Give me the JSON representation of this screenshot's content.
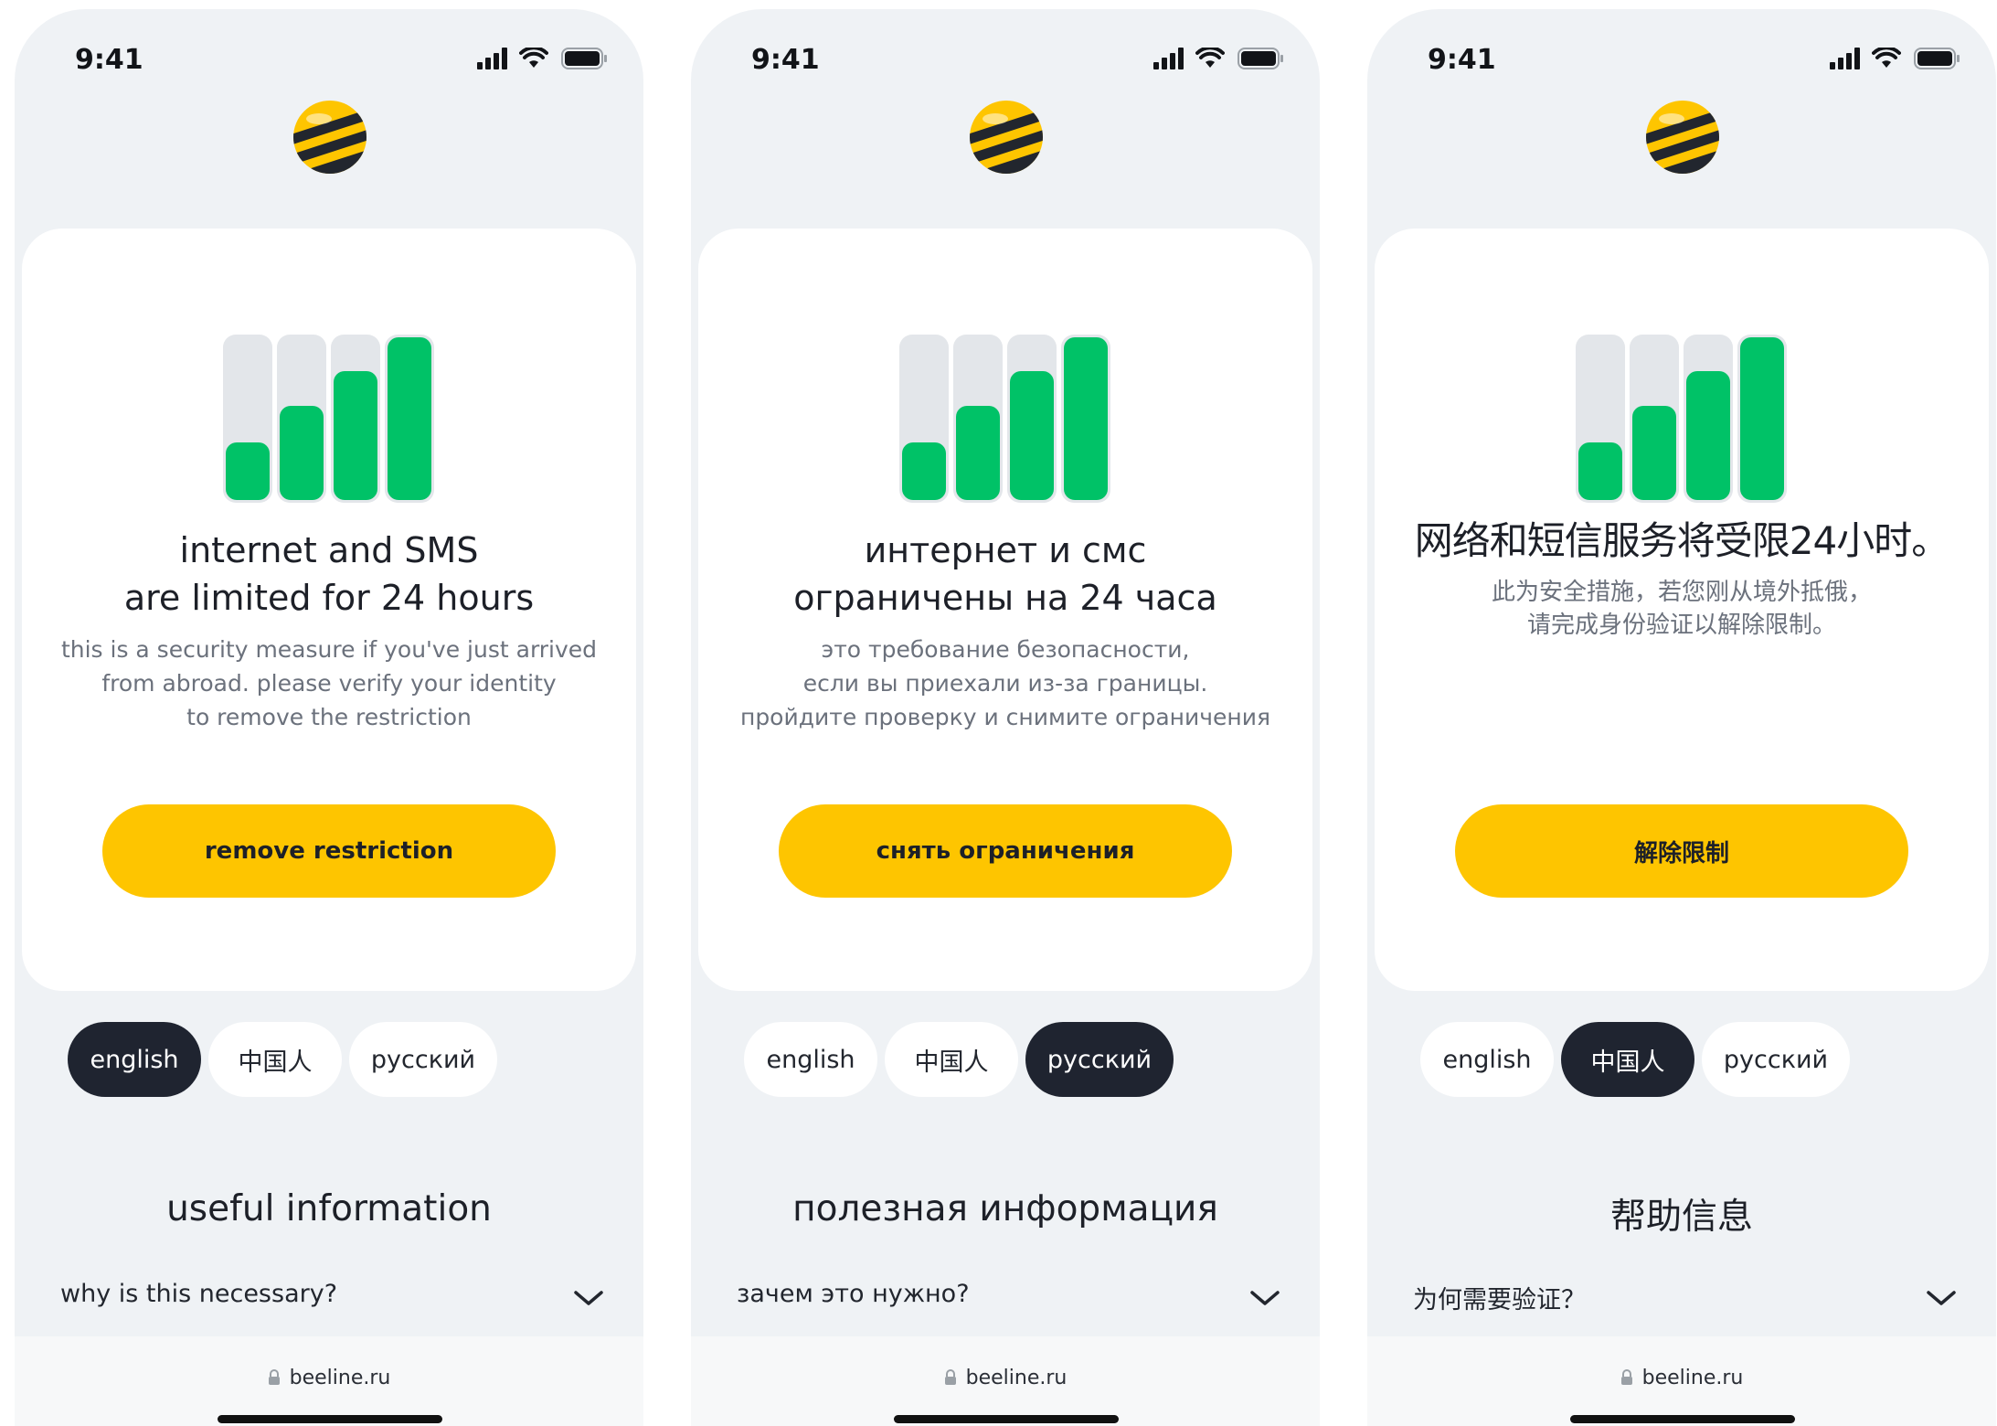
{
  "status_bar": {
    "time": "9:41"
  },
  "brand": {
    "yellow": "#fec500",
    "dark": "#22262e",
    "green": "#00c267"
  },
  "browser": {
    "url": "beeline.ru"
  },
  "languages": [
    "english",
    "中国人",
    "русский"
  ],
  "screens": [
    {
      "active_language": "english",
      "title": "internet and SMS\nare limited for 24 hours",
      "description": "this is a security measure if you've just arrived\nfrom abroad. please verify your identity\nto remove the restriction",
      "button": "remove restriction",
      "info_title": "useful information",
      "faq_question": "why is this necessary?"
    },
    {
      "active_language": "русский",
      "title": "интернет и смс\nограничены на 24 часа",
      "description": "это требование безопасности,\nесли вы приехали из-за границы.\nпройдите проверку и снимите ограничения",
      "button": "снять ограничения",
      "info_title": "полезная информация",
      "faq_question": "зачем это нужно?"
    },
    {
      "active_language": "中国人",
      "title": "网络和短信服务将受限24小时。",
      "description": "此为安全措施，若您刚从境外抵俄，\n请完成身份验证以解除限制。",
      "button": "解除限制",
      "info_title": "帮助信息",
      "faq_question": "为何需要验证？"
    }
  ]
}
